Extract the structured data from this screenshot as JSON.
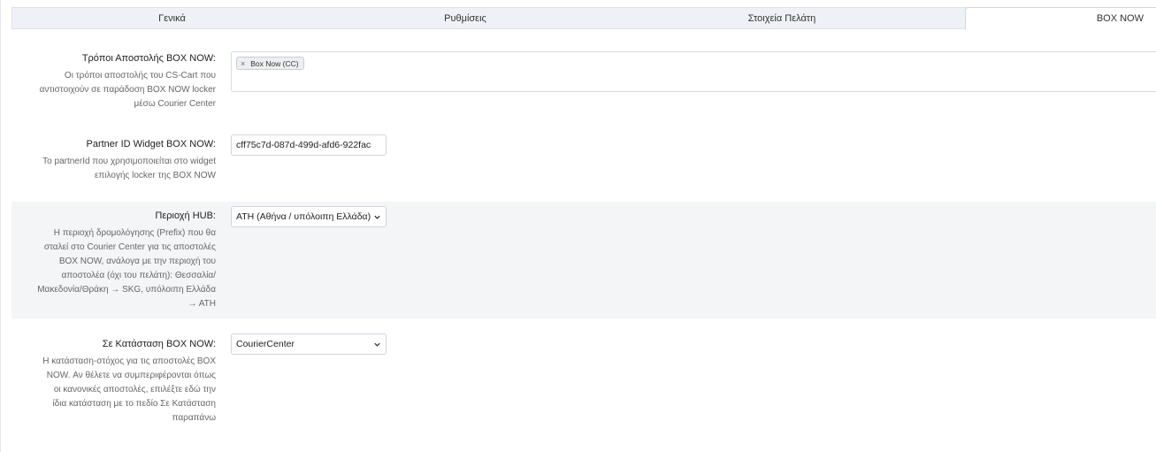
{
  "tabs": [
    {
      "label": "Γενικά"
    },
    {
      "label": "Ρυθμίσεις"
    },
    {
      "label": "Στοιχεία Πελάτη"
    },
    {
      "label": "BOX NOW"
    }
  ],
  "active_tab": "BOX NOW",
  "settings": {
    "shipping_methods": {
      "label": "Τρόποι Αποστολής BOX NOW:",
      "desc": [
        "Οι τρόποι αποστολής του CS-Cart που",
        "αντιστοιχούν σε παράδοση BOX NOW locker",
        "μέσω Courier Center"
      ],
      "selected": [
        {
          "label": "Box Now (CC)",
          "remove": "×"
        }
      ]
    },
    "partner_id": {
      "label": "Partner ID Widget BOX NOW:",
      "desc": [
        "Το partnerId που χρησιμοποιείται στο widget",
        "επιλογής locker της BOX NOW"
      ],
      "value": "cff75c7d-087d-499d-afd6-922fac"
    },
    "hub": {
      "label": "Περιοχή HUB:",
      "desc": [
        "Η περιοχή δρομολόγησης (Prefix) που θα",
        "σταλεί στο Courier Center για τις αποστολές",
        "BOX NOW, ανάλογα με την περιοχή του",
        "αποστολέα (όχι του πελάτη): Θεσσαλία/",
        "Μακεδονία/Θράκη → SKG, υπόλοιπη Ελλάδα",
        "→ ATH"
      ],
      "value": "ATH (Αθήνα / υπόλοιπη Ελλάδα)"
    },
    "status": {
      "label": "Σε Κατάσταση BOX NOW:",
      "desc": [
        "Η κατάσταση-στόχος για τις αποστολές BOX",
        "NOW. Αν θέλετε να συμπεριφέρονται όπως",
        "οι κανονικές αποστολές, επιλέξτε εδώ την",
        "ίδια κατάσταση με το πεδίο Σε Κατάσταση",
        "παραπάνω"
      ],
      "value": "CourierCenter"
    }
  },
  "icons": {
    "remove": "close-icon",
    "caret": "chevron-down-icon"
  },
  "colors": {
    "shaded_row": "#f4f5f7",
    "border": "#d7dbe0"
  }
}
